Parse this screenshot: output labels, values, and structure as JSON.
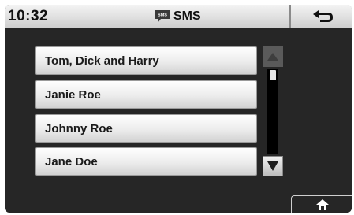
{
  "status_bar": {
    "time": "10:32",
    "app_title": "SMS",
    "app_icon": "sms-message-icon",
    "back_icon": "back-arrow-icon"
  },
  "contacts": [
    {
      "name": "Tom, Dick and Harry"
    },
    {
      "name": "Janie Roe"
    },
    {
      "name": "Johnny Roe"
    },
    {
      "name": "Jane Doe"
    }
  ],
  "scrollbar": {
    "up_icon": "scroll-up-arrow-icon",
    "down_icon": "scroll-down-arrow-icon",
    "up_enabled": false,
    "down_enabled": true
  },
  "home": {
    "icon": "home-icon"
  },
  "colors": {
    "screen_background": "#262626",
    "bar_light": "#f4f4f4",
    "bar_dark": "#cfcfcf",
    "text": "#111111"
  }
}
